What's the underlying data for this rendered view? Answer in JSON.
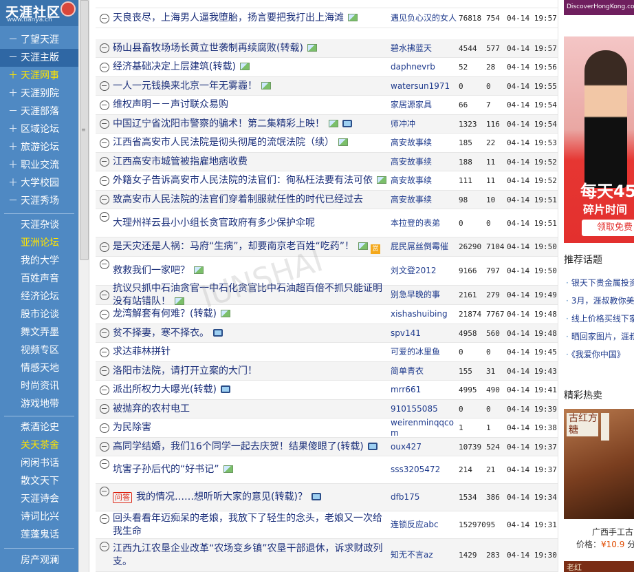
{
  "logo": {
    "name": "天涯社区",
    "url": "www.tianya.cn"
  },
  "sidebar": {
    "groups": [
      [
        {
          "prefix": "－",
          "label": "了望天涯"
        },
        {
          "prefix": "－",
          "label": "天涯主版",
          "active": true
        },
        {
          "prefix": "＋",
          "label": "天涯网事",
          "highlight": true
        },
        {
          "prefix": "＋",
          "label": "天涯别院"
        },
        {
          "prefix": "－",
          "label": "天涯部落"
        },
        {
          "prefix": "＋",
          "label": "区域论坛"
        },
        {
          "prefix": "＋",
          "label": "旅游论坛"
        },
        {
          "prefix": "＋",
          "label": "职业交流"
        },
        {
          "prefix": "＋",
          "label": "大学校园"
        },
        {
          "prefix": "－",
          "label": "天涯秀场"
        }
      ],
      [
        {
          "prefix": "",
          "label": "天涯杂谈"
        },
        {
          "prefix": "",
          "label": "亚洲论坛",
          "highlight": true
        },
        {
          "prefix": "",
          "label": "我的大学"
        },
        {
          "prefix": "",
          "label": "百姓声音"
        },
        {
          "prefix": "",
          "label": "经济论坛"
        },
        {
          "prefix": "",
          "label": "股市论谈"
        },
        {
          "prefix": "",
          "label": "舞文弄墨"
        },
        {
          "prefix": "",
          "label": "视频专区"
        },
        {
          "prefix": "",
          "label": "情感天地"
        },
        {
          "prefix": "",
          "label": "时尚资讯"
        },
        {
          "prefix": "",
          "label": "游戏地带"
        }
      ],
      [
        {
          "prefix": "",
          "label": "煮酒论史"
        },
        {
          "prefix": "",
          "label": "关天茶舍",
          "highlight": true
        },
        {
          "prefix": "",
          "label": "闲闲书话"
        },
        {
          "prefix": "",
          "label": "散文天下"
        },
        {
          "prefix": "",
          "label": "天涯诗会"
        },
        {
          "prefix": "",
          "label": "诗词比兴"
        },
        {
          "prefix": "",
          "label": "莲蓬鬼话"
        }
      ],
      [
        {
          "prefix": "",
          "label": "房产观澜"
        }
      ]
    ]
  },
  "posts": [
    {
      "title": "天良丧尽，上海男人逼我堕胎，扬言要把我打出上海滩",
      "img": true,
      "author": "遇见负心汉的女人",
      "clicks": "76818",
      "replies": "754",
      "time": "04-14 19:57"
    },
    {
      "title": "砀山县畜牧场场长黄立世袭制再续腐败(转载)",
      "img": true,
      "author": "碧水拂蓝天",
      "clicks": "4544",
      "replies": "577",
      "time": "04-14 19:57"
    },
    {
      "title": "经济基础决定上层建筑(转载)",
      "img": true,
      "author": "daphnevrb",
      "clicks": "52",
      "replies": "28",
      "time": "04-14 19:56"
    },
    {
      "title": "一人一元钱换来北京一年无雾霾！",
      "img": true,
      "author": "watersun1971",
      "clicks": "0",
      "replies": "0",
      "time": "04-14 19:55"
    },
    {
      "title": "维权声明－－声讨联众易购",
      "author": "家居源家具",
      "clicks": "66",
      "replies": "7",
      "time": "04-14 19:54"
    },
    {
      "title": "中国辽宁省沈阳市警察的骗术！第二集精彩上映！",
      "img": true,
      "video": true,
      "author": "师冲冲",
      "clicks": "1323",
      "replies": "116",
      "time": "04-14 19:54"
    },
    {
      "title": "江西省高安市人民法院是彻头彻尾的流氓法院（续）",
      "img": true,
      "author": "高安故事续",
      "clicks": "185",
      "replies": "22",
      "time": "04-14 19:53"
    },
    {
      "title": "江西高安市城管被指雇地痞收费",
      "author": "高安故事续",
      "clicks": "188",
      "replies": "11",
      "time": "04-14 19:52"
    },
    {
      "title": "外籍女子告诉高安市人民法院的法官们：徇私枉法要有法可依",
      "img": true,
      "author": "高安故事续",
      "clicks": "111",
      "replies": "11",
      "time": "04-14 19:52"
    },
    {
      "title": "致高安市人民法院的法官们穿着制服就任性的时代已经过去",
      "author": "高安故事续",
      "clicks": "98",
      "replies": "10",
      "time": "04-14 19:51"
    },
    {
      "title": "大理州祥云县小小组长贪官政府有多少保护伞呢",
      "author": "本拉登的表弟",
      "clicks": "0",
      "replies": "0",
      "time": "04-14 19:51"
    },
    {
      "title": "是天灾还是人祸：马府“生病”，却要南京老百姓“吃药”！",
      "img": true,
      "reward": true,
      "author": "屁民屌丝倒霉催",
      "clicks": "26290",
      "replies": "7104",
      "time": "04-14 19:50"
    },
    {
      "title": "救救我们一家吧？",
      "img": true,
      "author": "刘文登2012",
      "clicks": "9166",
      "replies": "797",
      "time": "04-14 19:50"
    },
    {
      "title": "抗议只抓中石油贪官一中石化贪官比中石油超百倍不抓只能证明没有站错队！",
      "img": true,
      "author": "别急早晚的事",
      "clicks": "2161",
      "replies": "279",
      "time": "04-14 19:49"
    },
    {
      "title": "龙湾解套有何难？(转载)",
      "img": true,
      "author": "xishashuibing",
      "clicks": "21874",
      "replies": "7767",
      "time": "04-14 19:48"
    },
    {
      "title": "贫不择妻，寒不择衣。",
      "video": true,
      "author": "spv141",
      "clicks": "4958",
      "replies": "560",
      "time": "04-14 19:48"
    },
    {
      "title": "求达菲林拼针",
      "author": "可爱的冰里鱼",
      "clicks": "0",
      "replies": "0",
      "time": "04-14 19:45"
    },
    {
      "title": "洛阳市法院，请打开立案的大门！",
      "author": "简单青衣",
      "clicks": "155",
      "replies": "31",
      "time": "04-14 19:43"
    },
    {
      "title": "派出所权力大曝光(转载)",
      "video": true,
      "author": "mrr661",
      "clicks": "4995",
      "replies": "490",
      "time": "04-14 19:41"
    },
    {
      "title": "被抛弃的农村电工",
      "author": "910155085",
      "clicks": "0",
      "replies": "0",
      "time": "04-14 19:39"
    },
    {
      "title": "为民除害",
      "author": "weirenminqqcom",
      "clicks": "1",
      "replies": "1",
      "time": "04-14 19:38"
    },
    {
      "title": "高同学结婚，我们16个同学一起去庆贺！结果傻眼了(转载)",
      "video": true,
      "author": "oux427",
      "clicks": "10739",
      "replies": "524",
      "time": "04-14 19:37"
    },
    {
      "title": "坑害子孙后代的“好书记”",
      "img": true,
      "author": "sss3205472",
      "clicks": "214",
      "replies": "21",
      "time": "04-14 19:37"
    },
    {
      "title": "我的情况……想听听大家的意见(转载)？",
      "qa": "问答",
      "video": true,
      "author": "dfb175",
      "clicks": "1534",
      "replies": "386",
      "time": "04-14 19:34"
    },
    {
      "title": "回头看看年迈痴呆的老娘，我放下了轻生的念头，老娘又一次给我生命",
      "author": "连锁反应abc",
      "clicks": "152970",
      "replies": "95",
      "time": "04-14 19:31"
    },
    {
      "title": "江西九江农垦企业改革“农场变乡镇”农垦干部退休，诉求财政列支。",
      "author": "知无不言az",
      "clicks": "1429",
      "replies": "283",
      "time": "04-14 19:30"
    }
  ],
  "right": {
    "ad_top": "DiscoverHongKong.com",
    "ad_big_line1": "每天45",
    "ad_big_line2": "碎片时间",
    "ad_big_button": "领取免费",
    "topics_title": "推荐话题",
    "topics": [
      "银天下贵金属投资",
      "3月，涯叔教你美",
      "线上价格买线下家",
      "晒回家图片，涯叔",
      "《我爱你中国》"
    ],
    "hot_title": "精彩热卖",
    "product_tag": "古红方糖",
    "product_name": "广西手工古",
    "product_price_label": "价格：",
    "product_price_value": "¥10.9",
    "product_price_suffix": "分",
    "ad_bottom": "老红"
  },
  "watermark": "IUNSHAI"
}
